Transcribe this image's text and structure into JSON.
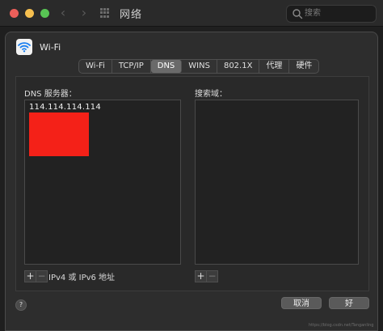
{
  "titlebar": {
    "title": "网络",
    "back_icon": "chevron-left-icon",
    "forward_icon": "chevron-right-icon",
    "grid_icon": "grid-icon",
    "search_placeholder": "搜索"
  },
  "interface": {
    "name": "Wi-Fi",
    "icon": "wifi-icon"
  },
  "tabs": [
    {
      "label": "Wi-Fi",
      "active": false
    },
    {
      "label": "TCP/IP",
      "active": false
    },
    {
      "label": "DNS",
      "active": true
    },
    {
      "label": "WINS",
      "active": false
    },
    {
      "label": "802.1X",
      "active": false
    },
    {
      "label": "代理",
      "active": false
    },
    {
      "label": "硬件",
      "active": false
    }
  ],
  "dns": {
    "label": "DNS 服务器：",
    "servers": [
      "114.114.114.114"
    ],
    "hint": "IPv4 或 IPv6 地址",
    "add_label": "+",
    "remove_label": "−"
  },
  "search_domains": {
    "label": "搜索域：",
    "domains": [],
    "add_label": "+",
    "remove_label": "−"
  },
  "footer": {
    "help_label": "?",
    "cancel_label": "取消",
    "ok_label": "好"
  },
  "watermark": "https://blog.csdn.net/Tanganling",
  "colors": {
    "redaction": "#f42118",
    "active_tab": "#6a6a6a"
  }
}
